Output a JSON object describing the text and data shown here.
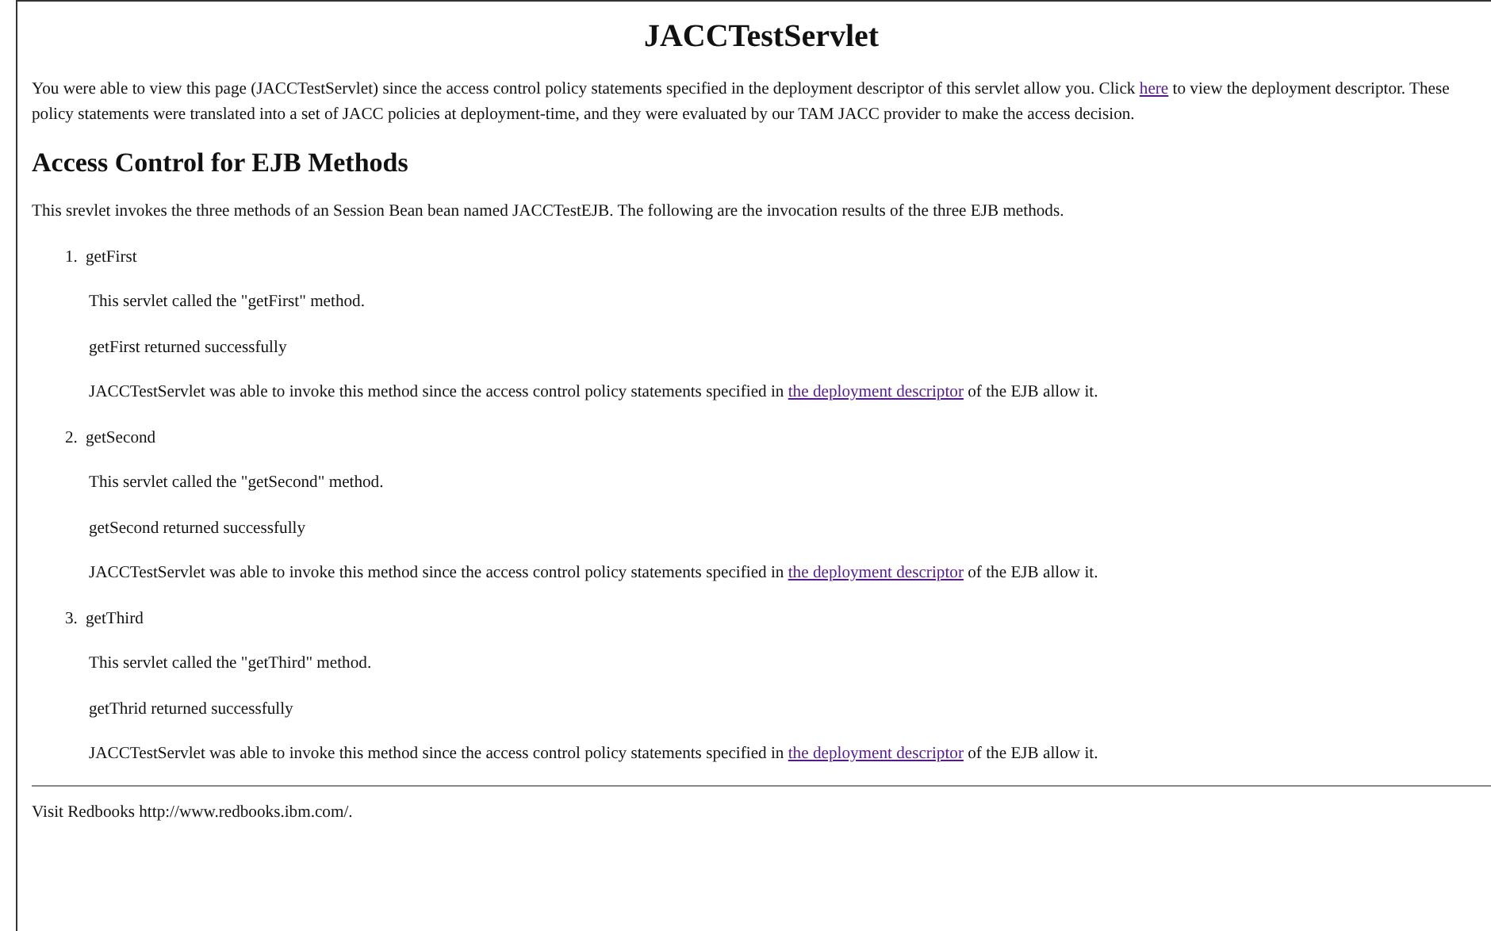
{
  "title": "JACCTestServlet",
  "intro": {
    "before": "You were able to view this page (JACCTestServlet) since the access control policy statements specified in the deployment descriptor of this servlet allow you. Click ",
    "link": "here",
    "after": " to view the deployment descriptor. These policy statements were translated into a set of JACC policies at deployment-time, and they were evaluated by our TAM JACC provider to make the access decision."
  },
  "section": {
    "heading": "Access Control for EJB Methods",
    "text": "This srevlet invokes the three methods of an Session Bean bean named JACCTestEJB. The following are the invocation results of the three EJB methods.",
    "methods": [
      {
        "number": "1.",
        "name": "getFirst",
        "called": "This servlet called the \"getFirst\" method.",
        "result": "getFirst returned successfully",
        "statement": {
          "before": "JACCTestServlet was able to invoke this method since the access control policy statements specified in ",
          "link": "the deployment descriptor",
          "after": " of the EJB allow it."
        }
      },
      {
        "number": "2.",
        "name": "getSecond",
        "called": "This servlet called the \"getSecond\" method.",
        "result": "getSecond returned successfully",
        "statement": {
          "before": "JACCTestServlet was able to invoke this method since the access control policy statements specified in ",
          "link": "the deployment descriptor",
          "after": " of the EJB allow it."
        }
      },
      {
        "number": "3.",
        "name": "getThird",
        "called": "This servlet called the \"getThird\" method.",
        "result": "getThrid returned successfully",
        "statement": {
          "before": "JACCTestServlet was able to invoke this method since the access control policy statements specified in ",
          "link": "the deployment descriptor",
          "after": " of the EJB allow it."
        }
      }
    ]
  },
  "footer": "Visit Redbooks http://www.redbooks.ibm.com/."
}
